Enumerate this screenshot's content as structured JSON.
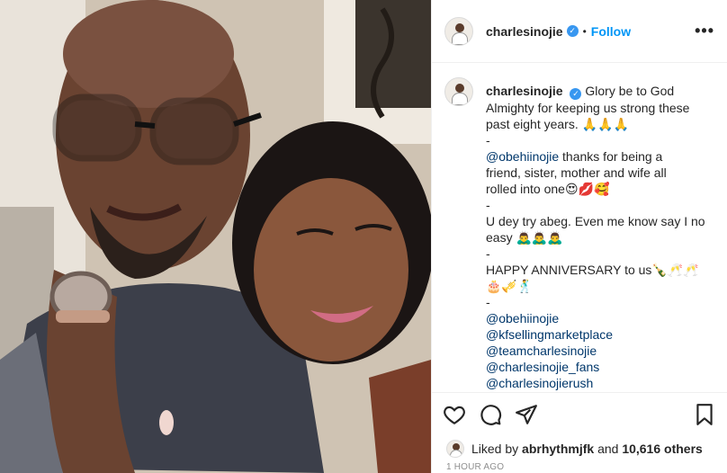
{
  "header": {
    "username": "charlesinojie",
    "follow_label": "Follow",
    "dot": "•",
    "more_label": "•••",
    "verified_mark": "✓"
  },
  "caption": {
    "username": "charlesinojie",
    "lines": [
      "Glory be to God",
      "Almighty for keeping us strong these",
      "past eight years. 🙏🙏🙏",
      "-",
      "@obehiinojie",
      " thanks for being a",
      "friend, sister, mother and wife all",
      "rolled into one😍💋🥰",
      "-",
      "U dey try abeg. Even me know say I no",
      "easy 🙇‍♂️🙇‍♂️🙇‍♂️",
      "-",
      "HAPPY ANNIVERSARY to us🍾🥂🥂",
      "🎂🎺🕺",
      "-",
      "@obehiinojie",
      "@kfsellingmarketplace",
      "@teamcharlesinojie",
      "@charlesinojie_fans",
      "@charlesinojierush"
    ]
  },
  "likes": {
    "prefix": "Liked by ",
    "user": "abrhythmjfk",
    "middle": " and ",
    "others": "10,616 others"
  },
  "timestamp": "1 HOUR AGO",
  "icons": [
    "heart-icon",
    "comment-icon",
    "share-icon",
    "bookmark-icon",
    "more-options-icon"
  ]
}
